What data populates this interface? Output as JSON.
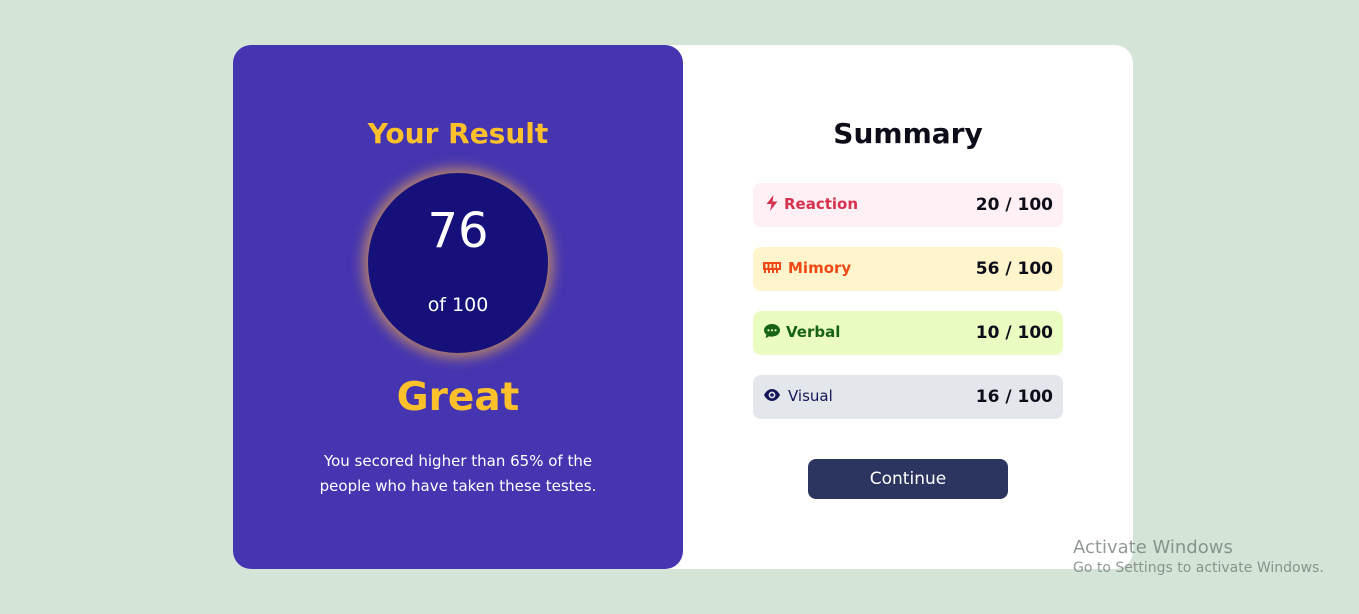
{
  "result": {
    "title": "Your Result",
    "score": "76",
    "total": "of 100",
    "rating": "Great",
    "description": "You secored higher than 65% of the people who have taken these testes."
  },
  "summary": {
    "title": "Summary",
    "categories": [
      {
        "label": "Reaction",
        "score": "20 / 100",
        "icon": "lightning-icon",
        "color": "#d6324f",
        "bg": "#fff0f5"
      },
      {
        "label": "Mimory",
        "score": "56 / 100",
        "icon": "memory-icon",
        "color": "#ef4a16",
        "bg": "#fff4cc"
      },
      {
        "label": "Verbal",
        "score": "10 / 100",
        "icon": "chat-icon",
        "color": "#176314",
        "bg": "#ebfcc3"
      },
      {
        "label": "Visual",
        "score": "16 / 100",
        "icon": "eye-icon",
        "color": "#141459",
        "bg": "#e3e7eb"
      }
    ],
    "continue_label": "Continue"
  },
  "watermark": {
    "title": "Activate Windows",
    "subtitle": "Go to Settings to activate Windows."
  },
  "colors": {
    "page_bg": "#d4e5d8",
    "result_panel": "#4535b1",
    "accent_yellow": "#fcc12a",
    "circle": "#16107a",
    "button": "#2b3560"
  }
}
